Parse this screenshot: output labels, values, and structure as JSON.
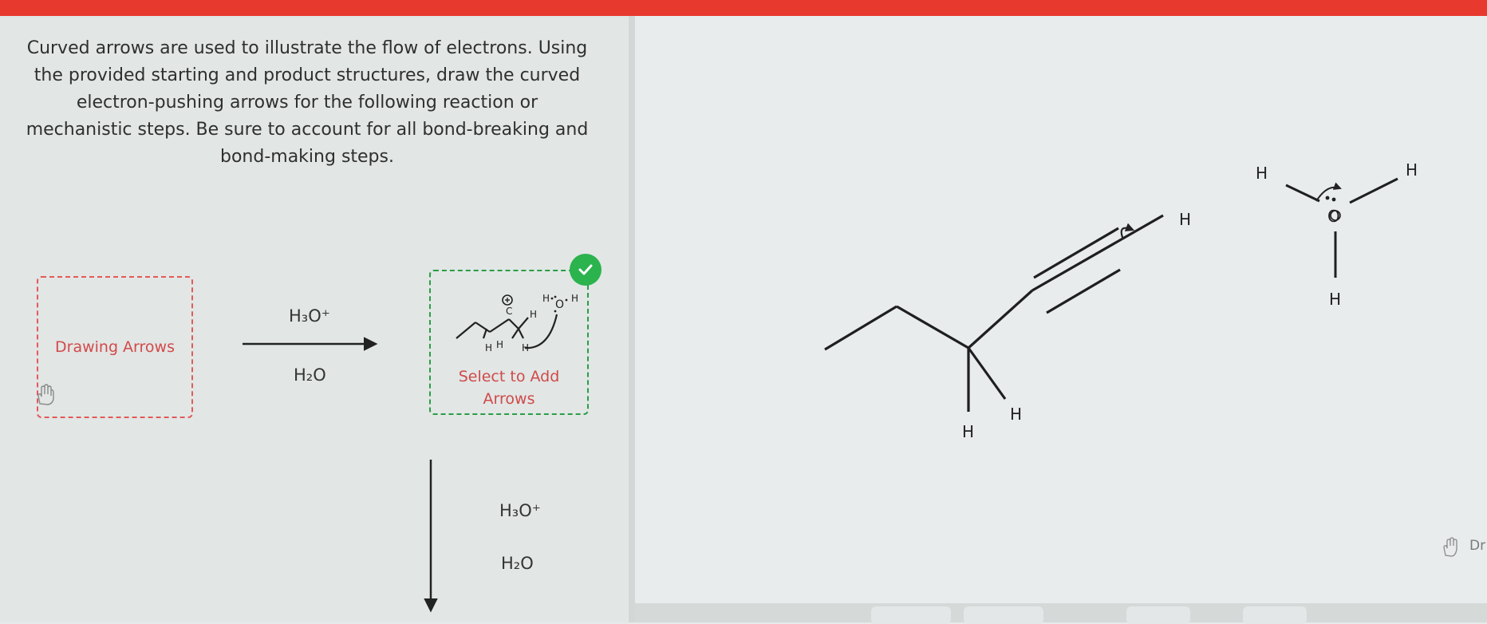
{
  "instructions": "Curved arrows are used to illustrate the flow of electrons. Using the provided starting and product structures, draw the curved electron-pushing arrows for the following reaction or mechanistic steps. Be sure to account for all bond-breaking and bond-making steps.",
  "left_box": {
    "label": "Drawing Arrows"
  },
  "mid_box": {
    "label": "Select to Add Arrows"
  },
  "reagents_top": {
    "above": "H₃O⁺",
    "below": "H₂O"
  },
  "reagents_down": {
    "top": "H₃O⁺",
    "bottom": "H₂O"
  },
  "atoms": {
    "h": "H",
    "o": "O",
    "c": "C"
  },
  "right_edge_label": "Dr",
  "colors": {
    "red_bar": "#e8392f",
    "red_box": "#e25a5a",
    "green_box": "#2a9d47",
    "check": "#2bb34e"
  },
  "icons": [
    "hand-icon",
    "check-icon",
    "trash-icon",
    "undo-icon",
    "redo-icon"
  ]
}
